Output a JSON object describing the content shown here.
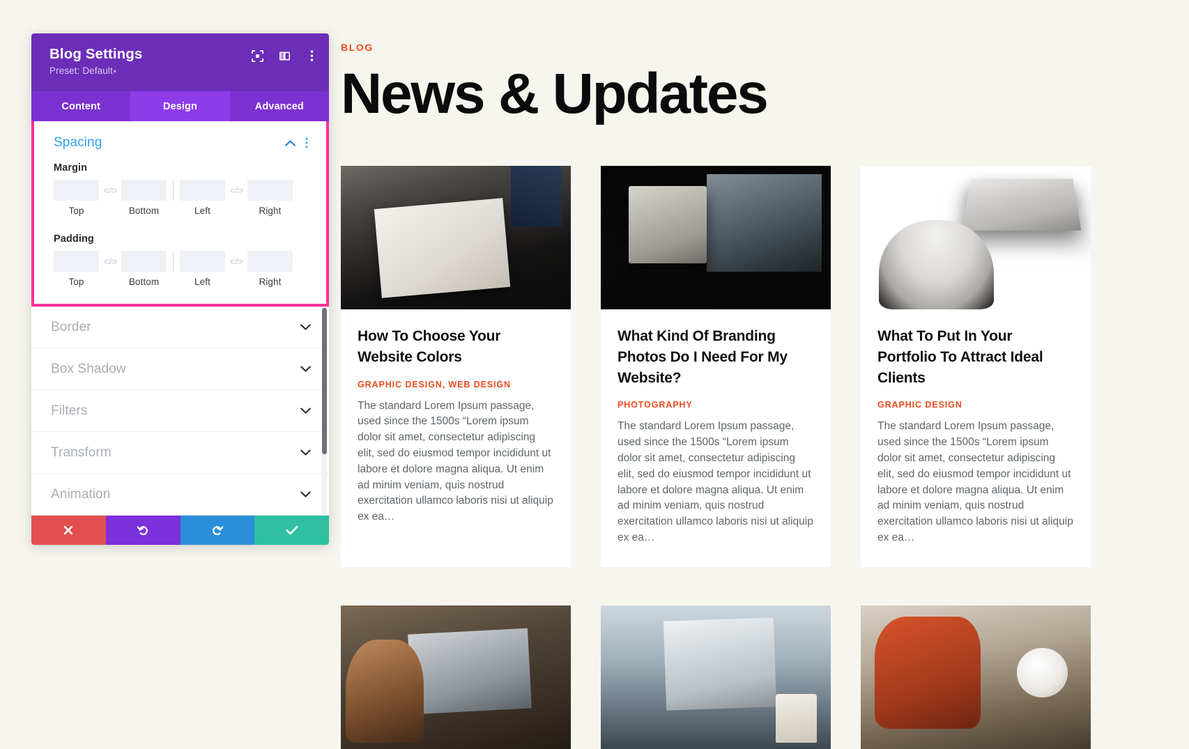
{
  "settings_panel": {
    "title": "Blog Settings",
    "preset_label": "Preset: Default",
    "preset_caret": "▾",
    "header_icons": [
      {
        "name": "focus-icon"
      },
      {
        "name": "layout-panel-icon"
      },
      {
        "name": "more-options-icon"
      }
    ],
    "tabs": [
      {
        "label": "Content",
        "active": false
      },
      {
        "label": "Design",
        "active": true
      },
      {
        "label": "Advanced",
        "active": false
      }
    ],
    "spacing_section": {
      "title": "Spacing",
      "collapse_icon": "chevron-up-icon",
      "options_icon": "more-options-icon",
      "margin": {
        "label": "Margin",
        "fields": [
          {
            "label": "Top",
            "value": ""
          },
          {
            "label": "Bottom",
            "value": ""
          },
          {
            "label": "Left",
            "value": ""
          },
          {
            "label": "Right",
            "value": ""
          }
        ],
        "link_icon": "link-broken-icon"
      },
      "padding": {
        "label": "Padding",
        "fields": [
          {
            "label": "Top",
            "value": ""
          },
          {
            "label": "Bottom",
            "value": ""
          },
          {
            "label": "Left",
            "value": ""
          },
          {
            "label": "Right",
            "value": ""
          }
        ],
        "link_icon": "link-broken-icon"
      }
    },
    "collapsed_sections": [
      {
        "label": "Border"
      },
      {
        "label": "Box Shadow"
      },
      {
        "label": "Filters"
      },
      {
        "label": "Transform"
      },
      {
        "label": "Animation"
      }
    ],
    "footer_buttons": [
      {
        "name": "cancel-button",
        "icon": "close-icon",
        "color": "#e24f4f"
      },
      {
        "name": "undo-button",
        "icon": "undo-icon",
        "color": "#7a30da"
      },
      {
        "name": "redo-button",
        "icon": "redo-icon",
        "color": "#2a8fd8"
      },
      {
        "name": "save-button",
        "icon": "check-icon",
        "color": "#2ec0a0"
      }
    ],
    "highlight_color": "#ff2e9a",
    "accent_color": "#2ea3f2",
    "header_color": "#6c2eb9"
  },
  "blog": {
    "eyebrow": "BLOG",
    "title": "News & Updates",
    "accent_color": "#eb4d1f",
    "posts": [
      {
        "title": "How To Choose Your Website Colors",
        "categories": "GRAPHIC DESIGN, WEB DESIGN",
        "excerpt": "The standard Lorem Ipsum passage, used since the 1500s “Lorem ipsum dolor sit amet, consectetur adipiscing elit, sed do eiusmod tempor incididunt ut labore et dolore magna aliqua. Ut enim ad minim veniam, quis nostrud exercitation ullamco laboris nisi ut aliquip ex ea…",
        "thumb": "ph-1"
      },
      {
        "title": "What Kind Of Branding Photos Do I Need For My Website?",
        "categories": "PHOTOGRAPHY",
        "excerpt": "The standard Lorem Ipsum passage, used since the 1500s “Lorem ipsum dolor sit amet, consectetur adipiscing elit, sed do eiusmod tempor incididunt ut labore et dolore magna aliqua. Ut enim ad minim veniam, quis nostrud exercitation ullamco laboris nisi ut aliquip ex ea…",
        "thumb": "ph-2"
      },
      {
        "title": "What To Put In Your Portfolio To Attract Ideal Clients",
        "categories": "GRAPHIC DESIGN",
        "excerpt": "The standard Lorem Ipsum passage, used since the 1500s “Lorem ipsum dolor sit amet, consectetur adipiscing elit, sed do eiusmod tempor incididunt ut labore et dolore magna aliqua. Ut enim ad minim veniam, quis nostrud exercitation ullamco laboris nisi ut aliquip ex ea…",
        "thumb": "ph-3"
      },
      {
        "title": "",
        "categories": "",
        "excerpt": "",
        "thumb": "ph-4"
      },
      {
        "title": "",
        "categories": "",
        "excerpt": "",
        "thumb": "ph-5"
      },
      {
        "title": "",
        "categories": "",
        "excerpt": "",
        "thumb": "ph-6"
      }
    ]
  }
}
